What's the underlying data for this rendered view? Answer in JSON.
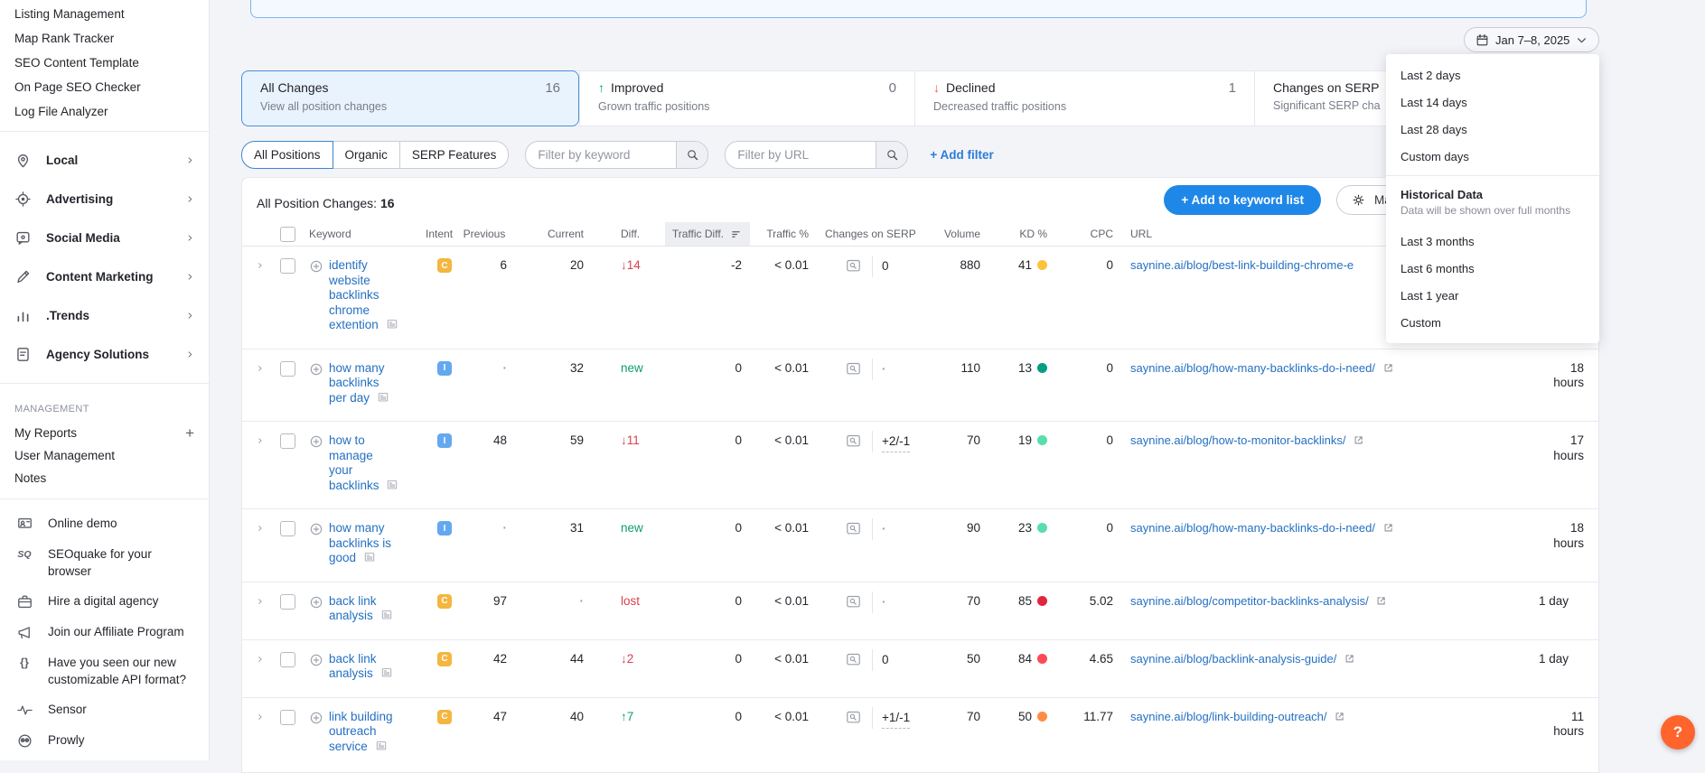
{
  "sidebar": {
    "top_links": [
      "Listing Management",
      "Map Rank Tracker",
      "SEO Content Template",
      "On Page SEO Checker",
      "Log File Analyzer"
    ],
    "tool_sections": [
      {
        "icon": "location-pin",
        "label": "Local"
      },
      {
        "icon": "target",
        "label": "Advertising"
      },
      {
        "icon": "chat-bubble",
        "label": "Social Media"
      },
      {
        "icon": "pencil",
        "label": "Content Marketing"
      },
      {
        "icon": "bar-chart",
        "label": ".Trends"
      },
      {
        "icon": "document",
        "label": "Agency Solutions"
      }
    ],
    "management_label": "MANAGEMENT",
    "management_items": [
      {
        "label": "My Reports",
        "suffix": "+"
      },
      {
        "label": "User Management",
        "suffix": ""
      },
      {
        "label": "Notes",
        "suffix": ""
      }
    ],
    "footer_items": [
      {
        "icon": "online-demo",
        "label": "Online demo"
      },
      {
        "icon": "seoquake",
        "label": "SEOquake for your browser"
      },
      {
        "icon": "briefcase",
        "label": "Hire a digital agency"
      },
      {
        "icon": "megaphone",
        "label": "Join our Affiliate Program"
      },
      {
        "icon": "braces",
        "label": "Have you seen our new customizable API format?"
      },
      {
        "icon": "pulse",
        "label": "Sensor"
      },
      {
        "icon": "owl",
        "label": "Prowly"
      }
    ]
  },
  "topbar": {
    "date_range": "Jan 7–8, 2025"
  },
  "date_dropdown": {
    "top_items": [
      "Last 2 days",
      "Last 14 days",
      "Last 28 days",
      "Custom days"
    ],
    "section_title": "Historical Data",
    "section_subtitle": "Data will be shown over full months",
    "bottom_items": [
      "Last 3 months",
      "Last 6 months",
      "Last 1 year",
      "Custom"
    ]
  },
  "summary_cards": [
    {
      "title": "All Changes",
      "count": "16",
      "subtitle": "View all position changes",
      "selected": true,
      "arrow": "",
      "arrow_color": ""
    },
    {
      "title": "Improved",
      "count": "0",
      "subtitle": "Grown traffic positions",
      "selected": false,
      "arrow": "up",
      "arrow_color": "#00a071"
    },
    {
      "title": "Declined",
      "count": "1",
      "subtitle": "Decreased traffic positions",
      "selected": false,
      "arrow": "down",
      "arrow_color": "#e8642e"
    },
    {
      "title": "Changes on SERP",
      "count": "",
      "subtitle": "Significant SERP cha",
      "selected": false,
      "arrow": "",
      "arrow_color": ""
    }
  ],
  "filters": {
    "position_tabs": [
      {
        "label": "All Positions",
        "selected": true
      },
      {
        "label": "Organic",
        "selected": false
      },
      {
        "label": "SERP Features",
        "selected": false
      }
    ],
    "keyword_placeholder": "Filter by keyword",
    "url_placeholder": "Filter by URL",
    "add_filter_label": "+ Add filter"
  },
  "table": {
    "title": "All Position Changes:",
    "count": "16",
    "add_to_keyword_list_label": "+ Add to keyword list",
    "manage_label": "Mana",
    "columns": [
      "Keyword",
      "Intent",
      "Previous",
      "Current",
      "Diff.",
      "Traffic Diff.",
      "Traffic %",
      "Changes on SERP",
      "Volume",
      "KD %",
      "CPC",
      "URL"
    ],
    "sorted_column": "Traffic Diff.",
    "rows": [
      {
        "keyword": "identify website backlinks chrome extention",
        "intent": "C",
        "previous": "6",
        "current": "20",
        "diff": "14",
        "diff_dir": "down",
        "traffic_diff": "-2",
        "traffic_pct": "< 0.01",
        "serp_changes": "0",
        "serp_dashed": false,
        "volume": "880",
        "kd": "41",
        "kd_color": "#fdc23c",
        "cpc": "0",
        "url": "saynine.ai/blog/best-link-building-chrome-e",
        "url_external": false,
        "age": ""
      },
      {
        "keyword": "how many backlinks per day",
        "intent": "I",
        "previous": "·",
        "current": "32",
        "diff": "new",
        "diff_dir": "new",
        "traffic_diff": "0",
        "traffic_pct": "< 0.01",
        "serp_changes": "·",
        "serp_dashed": false,
        "volume": "110",
        "kd": "13",
        "kd_color": "#009f81",
        "cpc": "0",
        "url": "saynine.ai/blog/how-many-backlinks-do-i-need/",
        "url_external": true,
        "age": "18 hours"
      },
      {
        "keyword": "how to manage your backlinks",
        "intent": "I",
        "previous": "48",
        "current": "59",
        "diff": "11",
        "diff_dir": "down",
        "traffic_diff": "0",
        "traffic_pct": "< 0.01",
        "serp_changes": "+2/-1",
        "serp_dashed": true,
        "volume": "70",
        "kd": "19",
        "kd_color": "#59ddaa",
        "cpc": "0",
        "url": "saynine.ai/blog/how-to-monitor-backlinks/",
        "url_external": true,
        "age": "17 hours"
      },
      {
        "keyword": "how many backlinks is good",
        "intent": "I",
        "previous": "·",
        "current": "31",
        "diff": "new",
        "diff_dir": "new",
        "traffic_diff": "0",
        "traffic_pct": "< 0.01",
        "serp_changes": "·",
        "serp_dashed": false,
        "volume": "90",
        "kd": "23",
        "kd_color": "#59ddaa",
        "cpc": "0",
        "url": "saynine.ai/blog/how-many-backlinks-do-i-need/",
        "url_external": true,
        "age": "18 hours"
      },
      {
        "keyword": "back link analysis",
        "intent": "C",
        "previous": "97",
        "current": "·",
        "diff": "lost",
        "diff_dir": "lost",
        "traffic_diff": "0",
        "traffic_pct": "< 0.01",
        "serp_changes": "·",
        "serp_dashed": false,
        "volume": "70",
        "kd": "85",
        "kd_color": "#e0263c",
        "cpc": "5.02",
        "url": "saynine.ai/blog/competitor-backlinks-analysis/",
        "url_external": true,
        "age": "1 day"
      },
      {
        "keyword": "back link analysis",
        "intent": "C",
        "previous": "42",
        "current": "44",
        "diff": "2",
        "diff_dir": "down",
        "traffic_diff": "0",
        "traffic_pct": "< 0.01",
        "serp_changes": "0",
        "serp_dashed": false,
        "volume": "50",
        "kd": "84",
        "kd_color": "#ff4953",
        "cpc": "4.65",
        "url": "saynine.ai/blog/backlink-analysis-guide/",
        "url_external": true,
        "age": "1 day"
      },
      {
        "keyword": "link building outreach service",
        "intent": "C",
        "previous": "47",
        "current": "40",
        "diff": "7",
        "diff_dir": "up",
        "traffic_diff": "0",
        "traffic_pct": "< 0.01",
        "serp_changes": "+1/-1",
        "serp_dashed": true,
        "volume": "70",
        "kd": "50",
        "kd_color": "#ff8c43",
        "cpc": "11.77",
        "url": "saynine.ai/blog/link-building-outreach/",
        "url_external": true,
        "age": "11 hours"
      }
    ]
  },
  "colors": {
    "accent_blue": "#1f87e8",
    "link_blue": "#2470c2",
    "help_orange": "#ff642d"
  },
  "help_button": {
    "label": "?"
  }
}
